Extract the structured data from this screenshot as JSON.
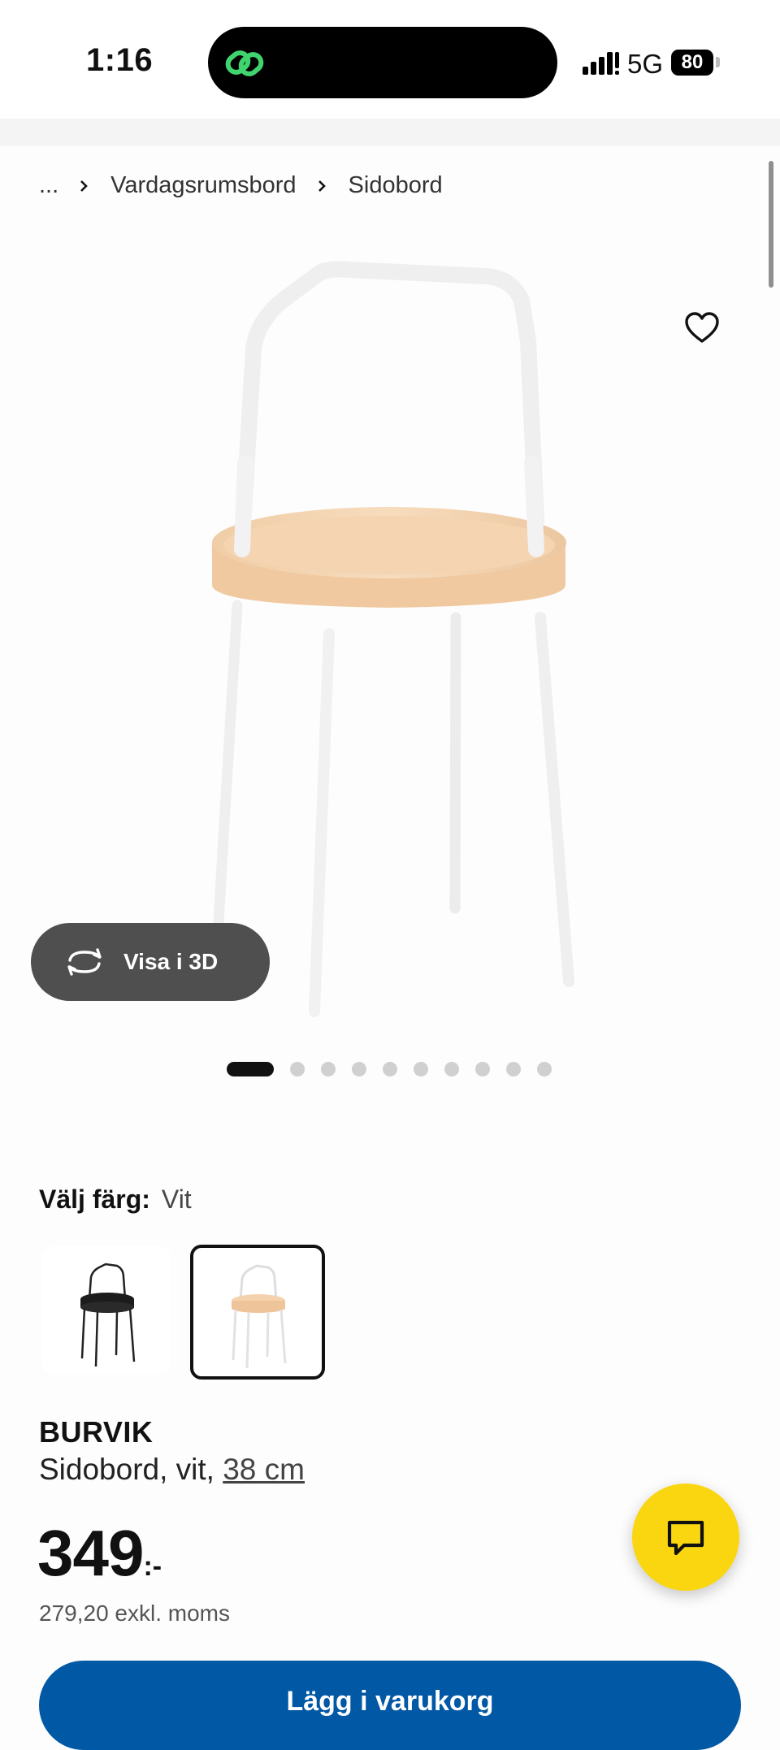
{
  "status_bar": {
    "time": "1:16",
    "network": "5G",
    "battery": "80"
  },
  "breadcrumb": {
    "ellipsis": "...",
    "items": [
      "Vardagsrumsbord",
      "Sidobord"
    ]
  },
  "gallery": {
    "view_3d_label": "Visa i 3D",
    "dot_count": 10,
    "active_index": 0
  },
  "color_select": {
    "label": "Välj färg:",
    "selected": "Vit",
    "options": [
      {
        "name": "black",
        "selected": false
      },
      {
        "name": "white",
        "selected": true
      }
    ]
  },
  "product": {
    "name": "BURVIK",
    "description": "Sidobord, vit,",
    "size": "38 cm",
    "price": "349",
    "price_suffix": ":-",
    "price_ex_vat": "279,20 exkl. moms"
  },
  "buy_button": {
    "label": "Lägg i varukorg"
  },
  "colors": {
    "buy_button_bg": "#0158a4",
    "chat_button_bg": "#fad611",
    "view_3d_bg": "#4f4f4f",
    "island_logo": "#3fd46e"
  }
}
